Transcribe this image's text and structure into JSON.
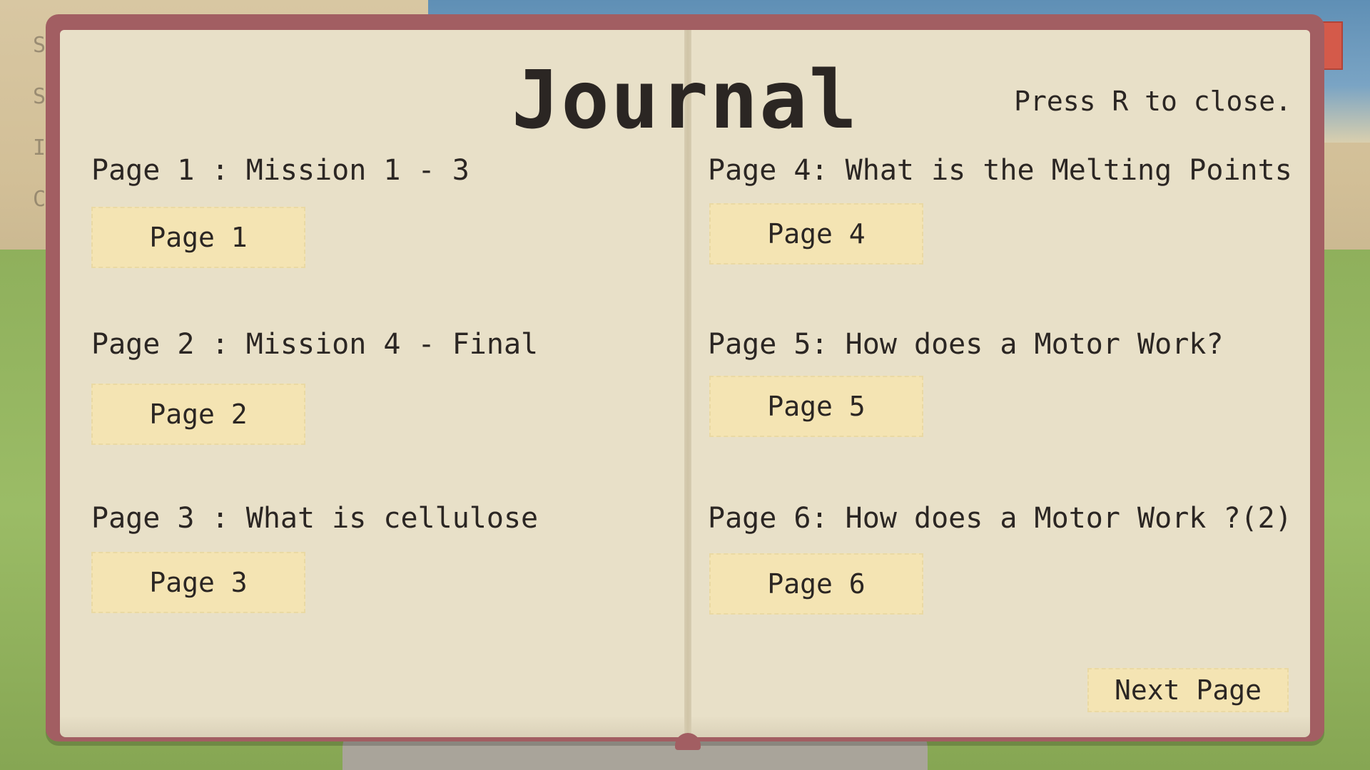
{
  "background": {
    "side_labels": [
      "S",
      "S",
      "In",
      "C"
    ]
  },
  "journal": {
    "title": "Journal",
    "close_hint": "Press R to close.",
    "left_entries": [
      {
        "heading": "Page 1 : Mission 1 - 3",
        "button": "Page 1"
      },
      {
        "heading": "Page 2 : Mission 4 - Final",
        "button": "Page 2"
      },
      {
        "heading": "Page 3 : What is cellulose",
        "button": "Page 3"
      }
    ],
    "right_entries": [
      {
        "heading": "Page 4: What is the Melting Points",
        "button": "Page 4"
      },
      {
        "heading": "Page 5: How does a Motor Work?",
        "button": "Page 5"
      },
      {
        "heading": "Page 6: How does a Motor Work ?(2)",
        "button": "Page 6"
      }
    ],
    "next_button": "Next Page"
  },
  "colors": {
    "book_cover": "#a25e62",
    "paper": "#e8e0c8",
    "button_fill": "#f4e4b3",
    "text": "#2b2623"
  }
}
